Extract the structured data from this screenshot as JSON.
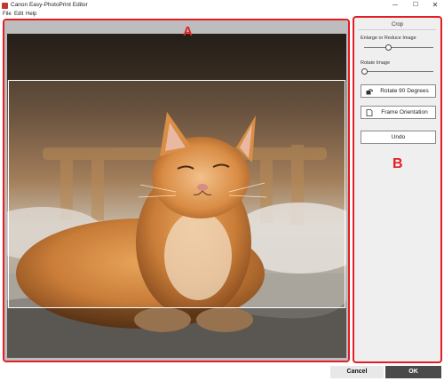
{
  "window": {
    "title": "Canon Easy-PhotoPrint Editor",
    "minimize_glyph": "─",
    "maximize_glyph": "☐",
    "close_glyph": "✕"
  },
  "menu": {
    "items": [
      "File",
      "Edit",
      "Help"
    ]
  },
  "preview": {
    "marker": "A"
  },
  "panel": {
    "marker": "B",
    "title": "Crop",
    "enlarge_label": "Enlarge or Reduce Image",
    "enlarge_value": 0.35,
    "rotate_label": "Rotate Image",
    "rotate_value": 0.0,
    "rotate90_label": "Rotate 90 Degrees",
    "frame_orientation_label": "Frame Orientation",
    "undo_label": "Undo"
  },
  "footer": {
    "cancel_label": "Cancel",
    "ok_label": "OK"
  },
  "colors": {
    "annotation_red": "#e31e24",
    "ok_button": "#4a4a4a",
    "panel_bg": "#efefef"
  },
  "icons": [
    "app-icon",
    "rotate-90-icon",
    "frame-orientation-icon"
  ]
}
